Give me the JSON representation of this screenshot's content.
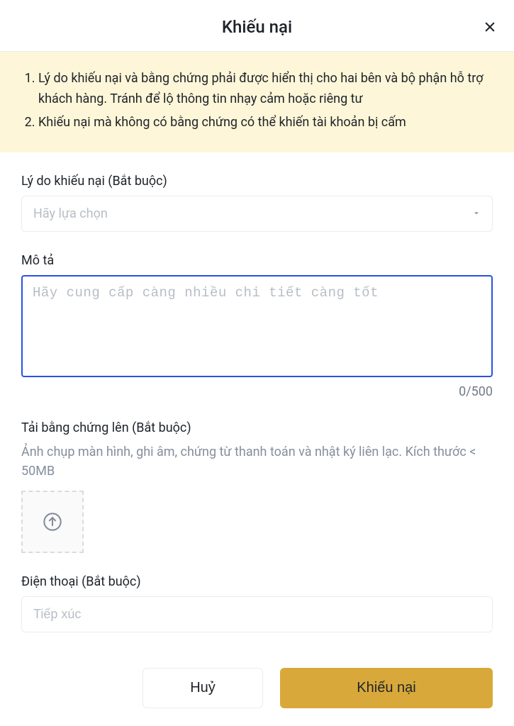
{
  "header": {
    "title": "Khiếu nại"
  },
  "notice": {
    "items": [
      "Lý do khiếu nại và bằng chứng phải được hiển thị cho hai bên và bộ phận hỗ trợ khách hàng. Tránh để lộ thông tin nhạy cảm hoặc riêng tư",
      "Khiếu nại mà không có bằng chứng có thể khiến tài khoản bị cấm"
    ]
  },
  "fields": {
    "reason": {
      "label": "Lý do khiếu nại (Bắt buộc)",
      "placeholder": "Hãy lựa chọn"
    },
    "description": {
      "label": "Mô tả",
      "placeholder": "Hãy cung cấp càng nhiều chi tiết càng tốt",
      "char_count": "0/500"
    },
    "upload": {
      "label": "Tải bằng chứng lên (Bắt buộc)",
      "help": "Ảnh chụp màn hình, ghi âm, chứng từ thanh toán và nhật ký liên lạc. Kích thước < 50MB"
    },
    "phone": {
      "label": "Điện thoại (Bắt buộc)",
      "placeholder": "Tiếp xúc"
    }
  },
  "footer": {
    "cancel": "Huỷ",
    "submit": "Khiếu nại"
  }
}
